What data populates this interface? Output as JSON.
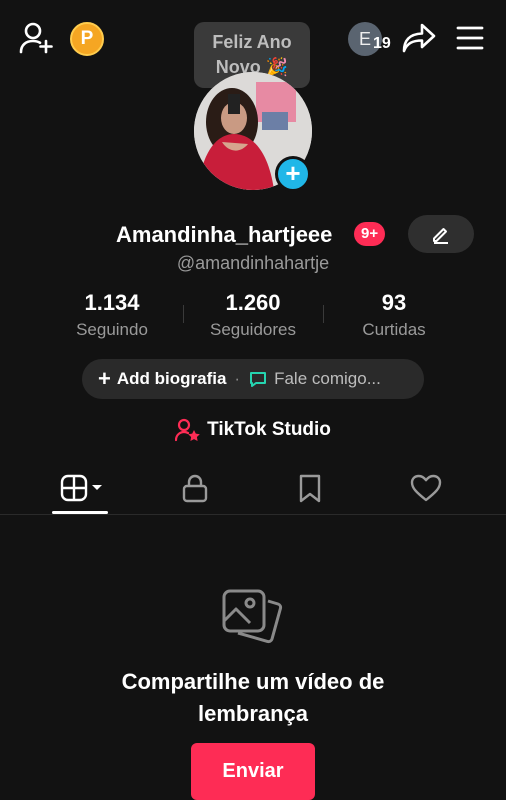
{
  "top_bar": {
    "coin_label": "P",
    "tooltip_line1": "Feliz Ano",
    "tooltip_line2": "Novo 🎉",
    "avatar_initial": "E",
    "avatar_count": "19"
  },
  "profile": {
    "username": "Amandinha_hartjeee",
    "notification_badge": "9+",
    "handle": "@amandinhahartje"
  },
  "stats": [
    {
      "value": "1.134",
      "label": "Seguindo"
    },
    {
      "value": "1.260",
      "label": "Seguidores"
    },
    {
      "value": "93",
      "label": "Curtidas"
    }
  ],
  "bio": {
    "add_label": "Add biografia",
    "chat_label": "Fale comigo..."
  },
  "studio_label": "TikTok Studio",
  "tabs": [
    "videos-tab",
    "private-tab",
    "saved-tab",
    "liked-tab"
  ],
  "empty_state": {
    "line1": "Compartilhe um vídeo de",
    "line2": "lembrança",
    "button": "Enviar"
  },
  "colors": {
    "accent": "#fe2c55",
    "plus_badge": "#20b7e8",
    "coin": "#f5a623",
    "chat_icon": "#25d4b0"
  }
}
